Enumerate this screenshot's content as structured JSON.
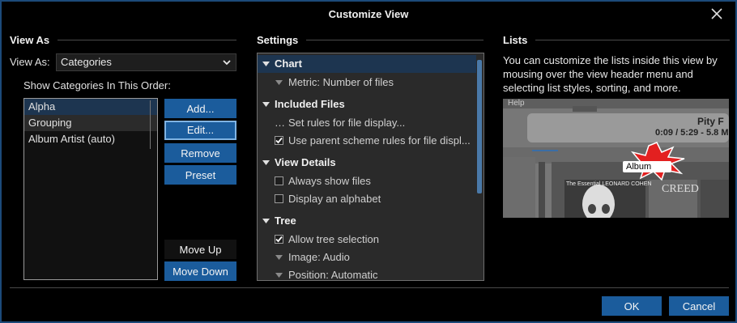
{
  "window": {
    "title": "Customize View"
  },
  "view_as": {
    "section_title": "View As",
    "label": "View As:",
    "selected": "Categories",
    "order_label": "Show Categories In This Order:",
    "categories": [
      "Alpha",
      "Grouping",
      "Album Artist (auto)"
    ],
    "buttons": {
      "add": "Add...",
      "edit": "Edit...",
      "remove": "Remove",
      "preset": "Preset",
      "move_up": "Move Up",
      "move_down": "Move Down"
    }
  },
  "settings": {
    "section_title": "Settings",
    "groups": [
      {
        "label": "Chart",
        "options": [
          "Metric: Number of files"
        ]
      },
      {
        "label": "Included Files",
        "options": [
          "Set rules for file display...",
          "Use parent scheme rules for file displ..."
        ]
      },
      {
        "label": "View Details",
        "options": [
          "Always show files",
          "Display an alphabet"
        ]
      },
      {
        "label": "Tree",
        "options": [
          "Allow tree selection",
          "Image: Audio",
          "Position: Automatic"
        ]
      }
    ],
    "checked": {
      "use_parent_rules": true,
      "always_show_files": false,
      "display_alphabet": false,
      "allow_tree_selection": true
    }
  },
  "lists": {
    "section_title": "Lists",
    "description": "You can customize the lists inside this view by mousing over the view header menu and selecting list styles, sorting, and more.",
    "preview": {
      "track_title": "Pity F",
      "time": "0:09 / 5:29 - 5.8 M",
      "header_label": "Album",
      "cover_text_1": "The Essential LEONARD COHEN",
      "cover_text_2": "CREED",
      "menu_fragment": "Help"
    }
  },
  "footer": {
    "ok": "OK",
    "cancel": "Cancel"
  },
  "colors": {
    "accent": "#1b5c9c",
    "selection": "#1d3550",
    "background": "#000000"
  }
}
